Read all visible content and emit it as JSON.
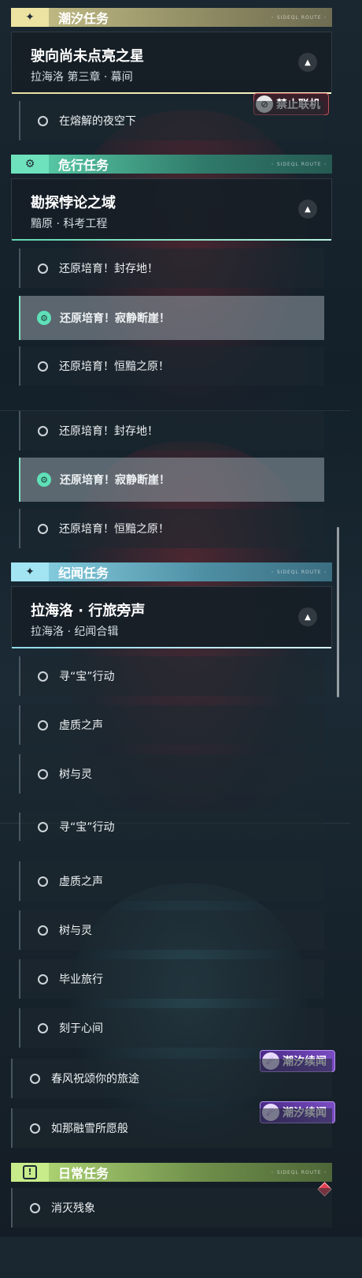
{
  "tidal": {
    "header": "潮汐任务",
    "header_tag": "◦ SIDEQL ROUTE ◦",
    "chapter_title": "驶向尚未点亮之星",
    "chapter_sub": "拉海洛 第三章 · 幕间",
    "lock_label": "禁止联机",
    "quests": [
      "在熔解的夜空下"
    ]
  },
  "danger": {
    "header": "危行任务",
    "header_tag": "◦ SIDEQL ROUTE ◦",
    "chapter_title": "勘探悖论之域",
    "chapter_sub": "黯原 · 科考工程",
    "quests_a": [
      "还原培育！封存地！",
      "还原培育！寂静断崖！",
      "还原培育！恒黯之原！"
    ],
    "quests_b": [
      "还原培育！封存地！",
      "还原培育！寂静断崖！",
      "还原培育！恒黯之原！"
    ]
  },
  "journal": {
    "header": "纪闻任务",
    "header_tag": "◦ SIDEQL ROUTE ◦",
    "chapter_title": "拉海洛 · 行旅旁声",
    "chapter_sub": "拉海洛 · 纪闻合辑",
    "quests_a": [
      "寻“宝”行动",
      "虚质之声",
      "树与灵"
    ],
    "quests_b": [
      "寻“宝”行动",
      "虚质之声",
      "树与灵",
      "毕业旅行",
      "刻于心间"
    ]
  },
  "sequel": {
    "chip_label": "潮汐续闻",
    "quests": [
      "春风祝颂你的旅途",
      "如那融雪所愿般"
    ]
  },
  "daily": {
    "header": "日常任务",
    "header_tag": "◦ SIDEQL ROUTE ◦",
    "quests": [
      "消灭残象"
    ]
  },
  "colors": {
    "tidal": "#e7dfa0",
    "danger": "#5fd8b0",
    "journal": "#8fd8ea",
    "daily": "#b8e07a",
    "sequel": "#6c3fb0"
  }
}
